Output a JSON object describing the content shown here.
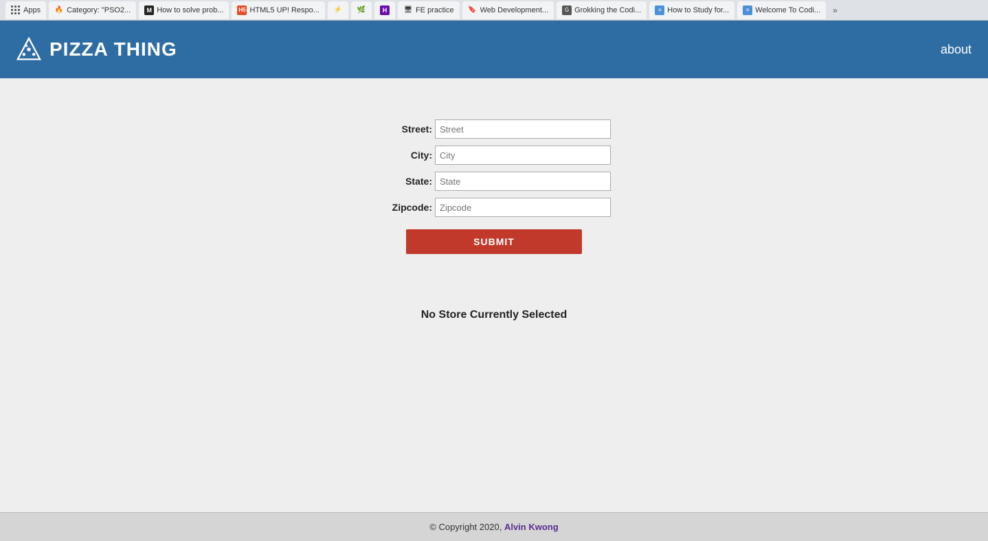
{
  "browser": {
    "tabs": [
      {
        "id": "apps",
        "label": "Apps",
        "type": "apps"
      },
      {
        "id": "pso2",
        "label": "Category: \"PSO2...",
        "type": "fire"
      },
      {
        "id": "solve",
        "label": "How to solve prob...",
        "type": "m"
      },
      {
        "id": "html5",
        "label": "HTML5 UP! Respo...",
        "type": "html5"
      },
      {
        "id": "uikit",
        "label": "",
        "type": "uikit"
      },
      {
        "id": "leaf",
        "label": "",
        "type": "leaf"
      },
      {
        "id": "h",
        "label": "",
        "type": "h"
      },
      {
        "id": "fe",
        "label": "FE practice",
        "type": "fe"
      },
      {
        "id": "webdev",
        "label": "Web Development...",
        "type": "bookmark"
      },
      {
        "id": "grokking",
        "label": "Grokking the Codi...",
        "type": "grokking"
      },
      {
        "id": "study",
        "label": "How to Study for...",
        "type": "study"
      },
      {
        "id": "welcome",
        "label": "Welcome To Codi...",
        "type": "welcome"
      }
    ],
    "more_label": "»"
  },
  "navbar": {
    "brand_name": "PIZZA THING",
    "about_label": "about"
  },
  "form": {
    "street_label": "Street:",
    "street_placeholder": "Street",
    "city_label": "City:",
    "city_placeholder": "City",
    "state_label": "State:",
    "state_placeholder": "State",
    "zipcode_label": "Zipcode:",
    "zipcode_placeholder": "Zipcode",
    "submit_label": "SUBMIT"
  },
  "status": {
    "no_store_message": "No Store Currently Selected"
  },
  "footer": {
    "copyright_text": "© Copyright 2020, ",
    "author_name": "Alvin Kwong",
    "author_url": "#"
  },
  "colors": {
    "navbar_bg": "#2e6da4",
    "submit_btn": "#c0392b",
    "footer_bg": "#d5d5d5"
  }
}
